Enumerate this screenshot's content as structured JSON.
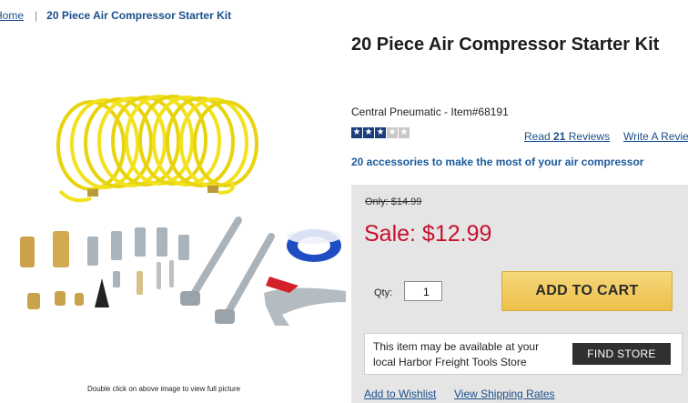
{
  "breadcrumb": {
    "home": "Home",
    "separator": "|",
    "current": "20 Piece Air Compressor Starter Kit"
  },
  "product": {
    "title": "20 Piece Air Compressor Starter Kit",
    "brand_item": "Central Pneumatic - Item#68191",
    "rating": {
      "stars": 3,
      "max": 5,
      "star_icon": "star-icon"
    },
    "reviews": {
      "read_prefix": "Read",
      "count": "21",
      "read_suffix": "Reviews",
      "write": "Write A Review"
    },
    "tagline": "20 accessories to make the most of your air compressor",
    "image_caption": "Double click on above image to view full picture"
  },
  "pricing": {
    "was": "Only: $14.99",
    "sale": "Sale: $12.99",
    "sale_color": "#c8102e"
  },
  "cart": {
    "qty_label": "Qty:",
    "qty_value": "1",
    "add_to_cart": "ADD TO CART",
    "button_color": "#f0c85a"
  },
  "store": {
    "message": "This item may be available at your local Harbor Freight Tools Store",
    "find_store": "FIND STORE"
  },
  "links": {
    "wishlist": "Add to Wishlist",
    "shipping": "View Shipping Rates"
  }
}
